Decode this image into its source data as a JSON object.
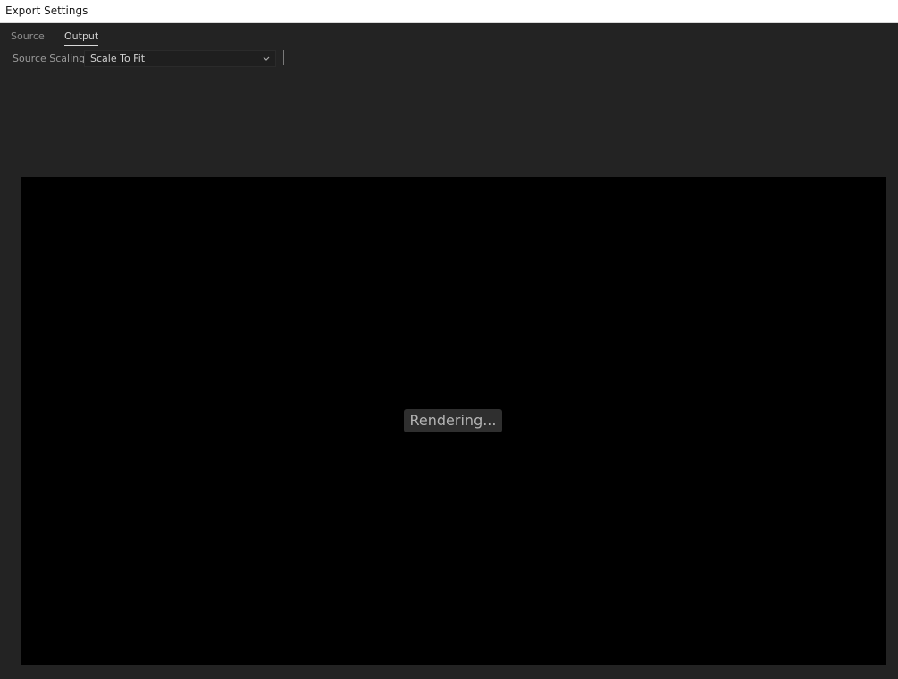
{
  "window": {
    "title": "Export Settings"
  },
  "tabs": [
    {
      "label": "Source",
      "active": false
    },
    {
      "label": "Output",
      "active": true
    }
  ],
  "source_scaling": {
    "label": "Source Scaling:",
    "selected": "Scale To Fit",
    "dropdown_icon": "chevron-down-icon"
  },
  "preview": {
    "status": "Rendering..."
  },
  "colors": {
    "panel_background": "#232323",
    "preview_background": "#000000",
    "title_bar": "#ffffff",
    "active_tab_underline": "#d9d9d9"
  }
}
